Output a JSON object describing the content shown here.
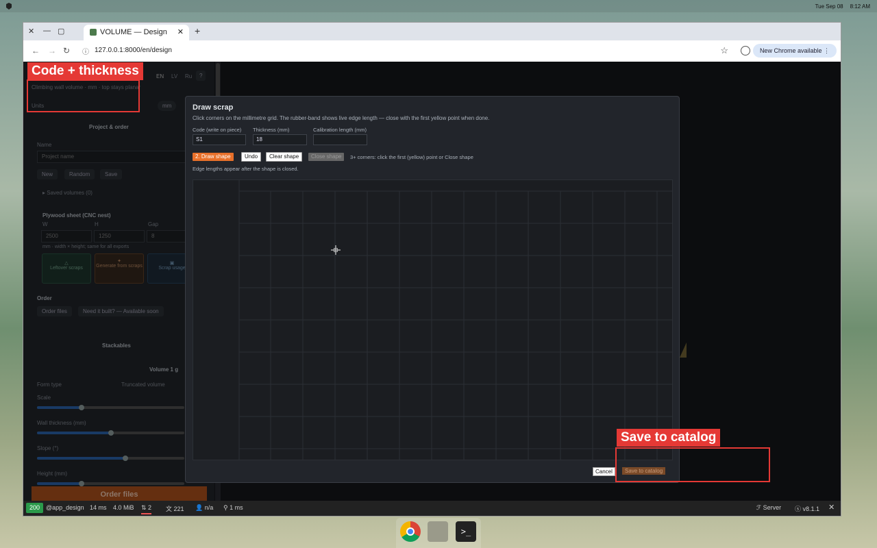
{
  "os": {
    "date": "Tue Sep 08",
    "time": "8:12 AM"
  },
  "browser": {
    "tab_title": "VOLUME — Design",
    "url": "127.0.0.1:8000/en/design",
    "update_label": "New Chrome available"
  },
  "sidebar": {
    "lang": [
      "EN",
      "LV",
      "Ru",
      "?"
    ],
    "subtitle": "Climbing wall volume · mm · top stays planar",
    "units_label": "Units",
    "units_value": "mm",
    "project_header": "Project & order",
    "name_label": "Name",
    "name_placeholder": "Project name",
    "btn_new": "New",
    "btn_random": "Random",
    "btn_save": "Save",
    "saved_volumes": "Saved volumes (0)",
    "plywood_header": "Plywood sheet (CNC nest)",
    "w_label": "W",
    "h_label": "H",
    "gap_label": "Gap",
    "w_value": "2500",
    "h_value": "1250",
    "gap_value": "8",
    "sheet_note": "mm · width × height; same for all exports",
    "card_leftover": "Leftover scraps",
    "card_generate": "Generate from scraps",
    "card_scrap": "Scrap usage",
    "order_label": "Order",
    "btn_order_files": "Order files",
    "btn_need_built": "Need it built? — Available soon",
    "stackables": "Stackables",
    "volume1": "Volume 1 g",
    "form_type": "Form type",
    "form_value": "Truncated volume",
    "scale": "Scale",
    "wall_thickness": "Wall thickness (mm)",
    "slope": "Slope (°)",
    "height": "Height (mm)",
    "order_files_big": "Order files"
  },
  "sliders": {
    "scale": 0.3,
    "wall": 0.5,
    "slope": 0.6,
    "height": 0.3
  },
  "modal": {
    "title": "Draw scrap",
    "description": "Click corners on the millimetre grid. The rubber-band shows live edge length — close with the first yellow point when done.",
    "code_label": "Code (write on piece)",
    "code_value": "S1",
    "thickness_label": "Thickness (mm)",
    "thickness_value": "18",
    "calib_label": "Calibration length (mm)",
    "calib_value": "",
    "btn_draw": "2. Draw shape",
    "btn_undo": "Undo",
    "btn_clear": "Clear shape",
    "btn_close": "Close shape",
    "hint": "3+ corners: click the first (yellow) point or Close shape",
    "edge_hint": "Edge lengths appear after the shape is closed.",
    "btn_cancel": "Cancel",
    "btn_save": "Save to catalog"
  },
  "devbar": {
    "status": "200",
    "route": "@app_design",
    "time": "14 ms",
    "memory": "4.0 MiB",
    "requests": "2",
    "translations": "221",
    "user": "n/a",
    "events": "1 ms",
    "server": "Server",
    "version": "v8.1.1"
  },
  "annotations": {
    "code": "Code + thickness",
    "save": "Save to catalog"
  },
  "colors": {
    "accent": "#e8702a",
    "annotation": "#e53935",
    "status_ok": "#2b9a4b"
  }
}
